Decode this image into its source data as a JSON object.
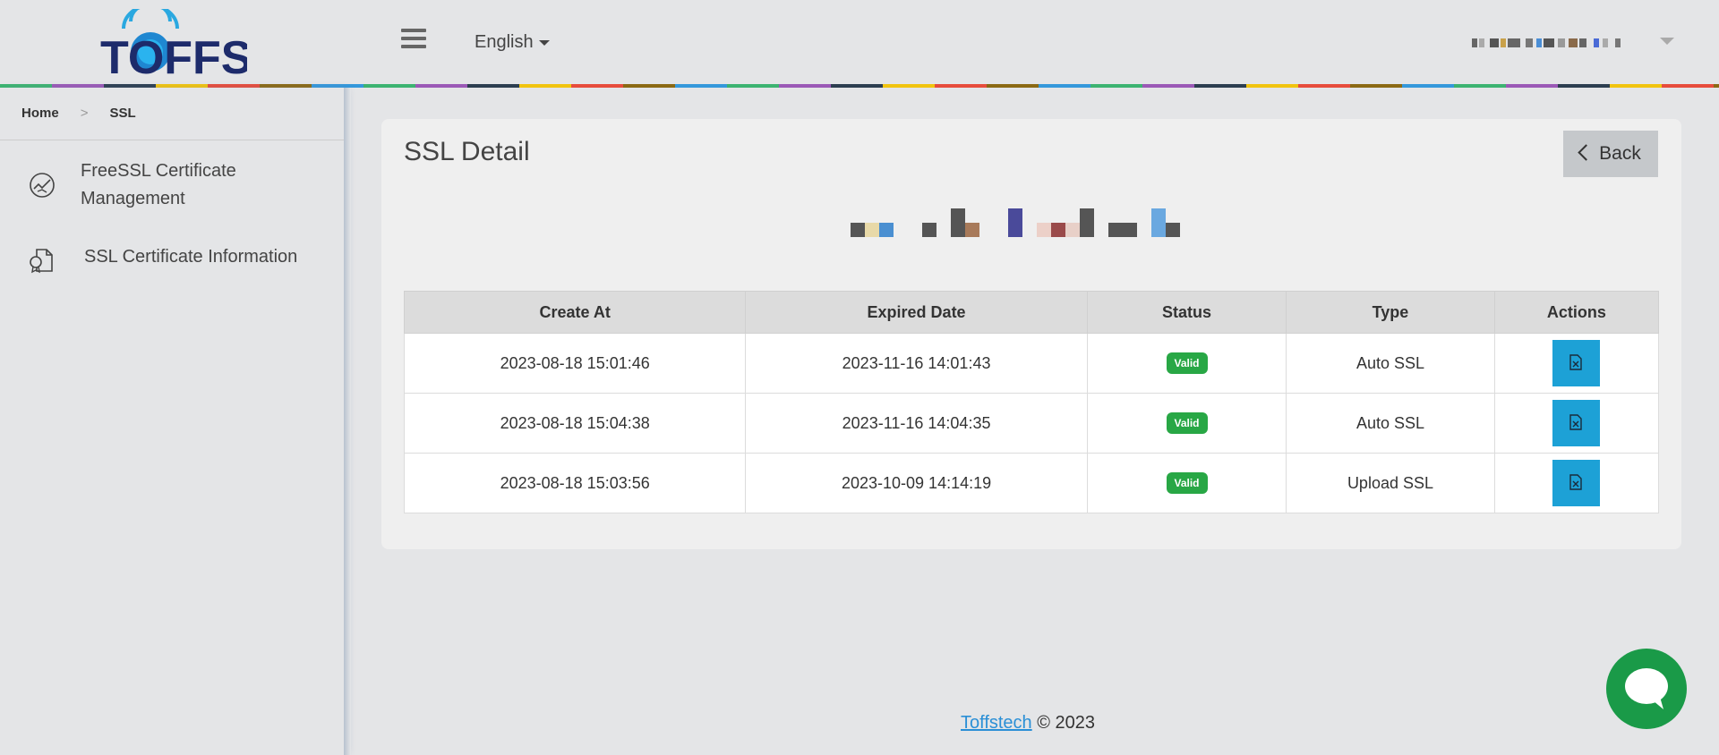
{
  "header": {
    "logo_text": "TOFFS",
    "language": "English"
  },
  "breadcrumb": {
    "home": "Home",
    "current": "SSL"
  },
  "sidebar": {
    "items": [
      {
        "label": "FreeSSL Certificate Management",
        "icon": "ssl-globe-icon"
      },
      {
        "label": "SSL Certificate Information",
        "icon": "certificate-doc-icon"
      }
    ]
  },
  "main": {
    "title": "SSL Detail",
    "back_label": "Back",
    "table": {
      "headers": [
        "Create At",
        "Expired Date",
        "Status",
        "Type",
        "Actions"
      ],
      "rows": [
        {
          "created": "2023-08-18 15:01:46",
          "expired": "2023-11-16 14:01:43",
          "status": "Valid",
          "type": "Auto SSL"
        },
        {
          "created": "2023-08-18 15:04:38",
          "expired": "2023-11-16 14:04:35",
          "status": "Valid",
          "type": "Auto SSL"
        },
        {
          "created": "2023-08-18 15:03:56",
          "expired": "2023-10-09 14:14:19",
          "status": "Valid",
          "type": "Upload SSL"
        }
      ]
    }
  },
  "footer": {
    "link": "Toffstech",
    "copyright": "© 2023"
  },
  "colors": {
    "accent": "#1da1d6",
    "valid_badge": "#28a745",
    "chat": "#1a9a48",
    "logo_navy": "#1d2b6b"
  }
}
